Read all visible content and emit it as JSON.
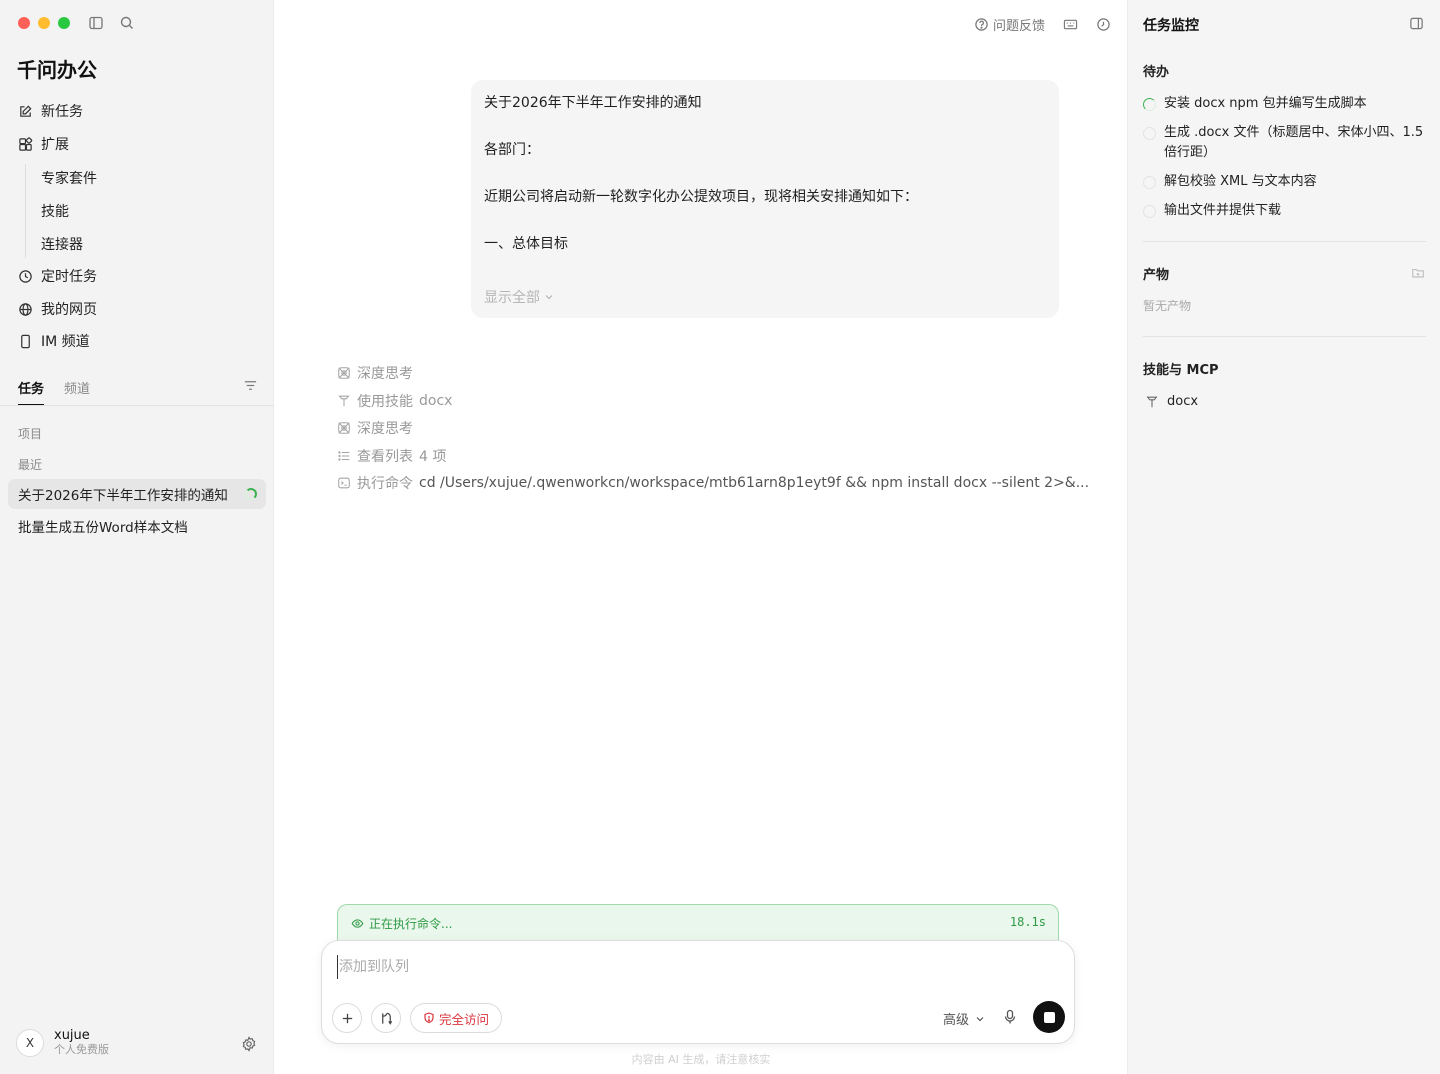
{
  "app": {
    "title": "千问办公"
  },
  "sidebar": {
    "nav": [
      {
        "label": "新任务",
        "icon": "edit-icon"
      },
      {
        "label": "扩展",
        "icon": "extensions-icon"
      }
    ],
    "extensions": [
      "专家套件",
      "技能",
      "连接器"
    ],
    "nav_more": [
      {
        "label": "定时任务",
        "icon": "clock-icon"
      },
      {
        "label": "我的网页",
        "icon": "globe-icon"
      },
      {
        "label": "IM 频道",
        "icon": "phone-icon"
      }
    ],
    "tabs": [
      {
        "label": "任务",
        "active": true
      },
      {
        "label": "频道",
        "active": false
      }
    ],
    "sections": {
      "projects": "项目",
      "recent": "最近"
    },
    "tasks": [
      {
        "title": "关于2026年下半年工作安排的通知",
        "active": true,
        "running": true
      },
      {
        "title": "批量生成五份Word样本文档",
        "active": false,
        "running": false
      }
    ],
    "user": {
      "initial": "X",
      "name": "xujue",
      "plan": "个人免费版"
    }
  },
  "header": {
    "feedback_label": "问题反馈"
  },
  "message": {
    "lines": [
      "关于2026年下半年工作安排的通知",
      "各部门：",
      "近期公司将启动新一轮数字化办公提效项目，现将相关安排通知如下：",
      "一、总体目标"
    ],
    "show_all_label": "显示全部"
  },
  "steps": [
    {
      "icon": "brain-icon",
      "label": "深度思考",
      "detail": ""
    },
    {
      "icon": "tool-icon",
      "label": "使用技能",
      "detail": "docx"
    },
    {
      "icon": "brain-icon",
      "label": "深度思考",
      "detail": ""
    },
    {
      "icon": "list-icon",
      "label": "查看列表",
      "detail": "4 项"
    },
    {
      "icon": "terminal-icon",
      "label": "执行命令",
      "detail": "cd /Users/xujue/.qwenworkcn/workspace/mtb61arn8p1eyt9f && npm install docx --silent 2>&..."
    }
  ],
  "status": {
    "label": "正在执行命令...",
    "elapsed": "18.1s",
    "color": "#2f9a45"
  },
  "composer": {
    "placeholder": "添加到队列",
    "access_label": "完全访问",
    "level_label": "高级",
    "disclaimer": "内容由 AI 生成，请注意核实"
  },
  "monitor": {
    "title": "任务监控",
    "todo_title": "待办",
    "todos": [
      {
        "text": "安装 docx npm 包并编写生成脚本",
        "status": "in-progress"
      },
      {
        "text": "生成 .docx 文件（标题居中、宋体小四、1.5 倍行距）",
        "status": "pending"
      },
      {
        "text": "解包校验 XML 与文本内容",
        "status": "pending"
      },
      {
        "text": "输出文件并提供下载",
        "status": "pending"
      }
    ],
    "artifacts_title": "产物",
    "artifacts_empty": "暂无产物",
    "skills_title": "技能与 MCP",
    "skills": [
      "docx"
    ]
  },
  "colors": {
    "accent_green": "#3bb24e",
    "danger_red": "#d9363e",
    "stop_button": "#111111"
  }
}
